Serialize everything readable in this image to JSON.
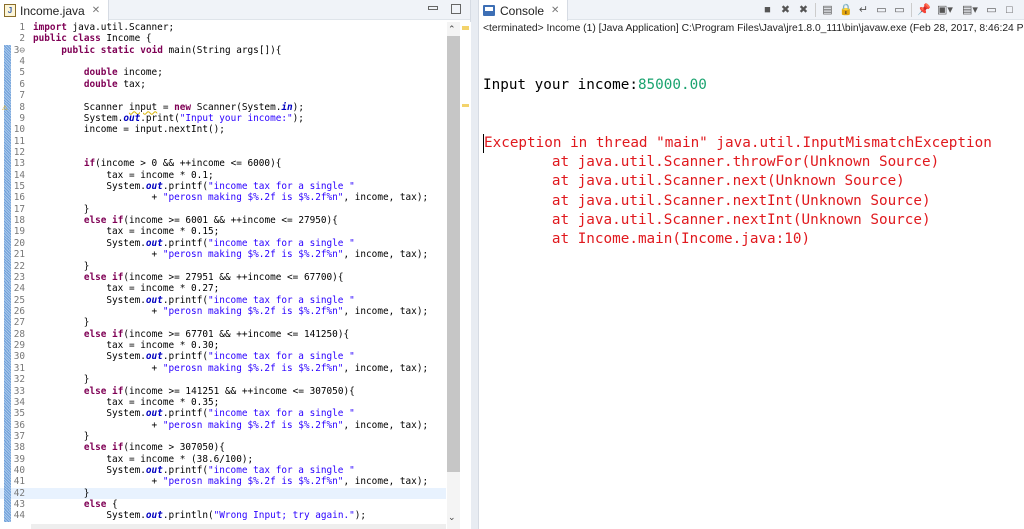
{
  "editor": {
    "tab_label": "Income.java",
    "close_glyph": "✕",
    "file_icon_letter": "J",
    "lines": [
      [
        [
          "kw",
          "import"
        ],
        [
          "p",
          " java.util.Scanner;"
        ]
      ],
      [
        [
          "kw",
          "public"
        ],
        [
          "p",
          " "
        ],
        [
          "kw",
          "class"
        ],
        [
          "p",
          " Income {"
        ]
      ],
      [
        [
          "p",
          "     "
        ],
        [
          "kw",
          "public"
        ],
        [
          "p",
          " "
        ],
        [
          "kw",
          "static"
        ],
        [
          "p",
          " "
        ],
        [
          "kw",
          "void"
        ],
        [
          "p",
          " main(String args[]){"
        ]
      ],
      [],
      [
        [
          "p",
          "         "
        ],
        [
          "kw",
          "double"
        ],
        [
          "p",
          " income;"
        ]
      ],
      [
        [
          "p",
          "         "
        ],
        [
          "kw",
          "double"
        ],
        [
          "p",
          " tax;"
        ]
      ],
      [],
      [
        [
          "p",
          "         Scanner "
        ],
        [
          "warn",
          "input"
        ],
        [
          "p",
          " = "
        ],
        [
          "kw",
          "new"
        ],
        [
          "p",
          " Scanner(System."
        ],
        [
          "fld",
          "in"
        ],
        [
          "p",
          ");"
        ]
      ],
      [
        [
          "p",
          "         System."
        ],
        [
          "fld",
          "out"
        ],
        [
          "p",
          ".print("
        ],
        [
          "str",
          "\"Input your income:\""
        ],
        [
          "p",
          ");"
        ]
      ],
      [
        [
          "p",
          "         income = input.nextInt();"
        ]
      ],
      [],
      [],
      [
        [
          "p",
          "         "
        ],
        [
          "kw",
          "if"
        ],
        [
          "p",
          "(income > 0 && ++income <= 6000){"
        ]
      ],
      [
        [
          "p",
          "             tax = income * 0.1;"
        ]
      ],
      [
        [
          "p",
          "             System."
        ],
        [
          "fld",
          "out"
        ],
        [
          "p",
          ".printf("
        ],
        [
          "str",
          "\"income tax for a single \""
        ]
      ],
      [
        [
          "p",
          "                     + "
        ],
        [
          "str",
          "\"perosn making $%.2f is $%.2f%n\""
        ],
        [
          "p",
          ", income, tax);"
        ]
      ],
      [
        [
          "p",
          "         }"
        ]
      ],
      [
        [
          "p",
          "         "
        ],
        [
          "kw",
          "else"
        ],
        [
          "p",
          " "
        ],
        [
          "kw",
          "if"
        ],
        [
          "p",
          "(income >= 6001 && ++income <= 27950){"
        ]
      ],
      [
        [
          "p",
          "             tax = income * 0.15;"
        ]
      ],
      [
        [
          "p",
          "             System."
        ],
        [
          "fld",
          "out"
        ],
        [
          "p",
          ".printf("
        ],
        [
          "str",
          "\"income tax for a single \""
        ]
      ],
      [
        [
          "p",
          "                     + "
        ],
        [
          "str",
          "\"perosn making $%.2f is $%.2f%n\""
        ],
        [
          "p",
          ", income, tax);"
        ]
      ],
      [
        [
          "p",
          "         }"
        ]
      ],
      [
        [
          "p",
          "         "
        ],
        [
          "kw",
          "else"
        ],
        [
          "p",
          " "
        ],
        [
          "kw",
          "if"
        ],
        [
          "p",
          "(income >= 27951 && ++income <= 67700){"
        ]
      ],
      [
        [
          "p",
          "             tax = income * 0.27;"
        ]
      ],
      [
        [
          "p",
          "             System."
        ],
        [
          "fld",
          "out"
        ],
        [
          "p",
          ".printf("
        ],
        [
          "str",
          "\"income tax for a single \""
        ]
      ],
      [
        [
          "p",
          "                     + "
        ],
        [
          "str",
          "\"perosn making $%.2f is $%.2f%n\""
        ],
        [
          "p",
          ", income, tax);"
        ]
      ],
      [
        [
          "p",
          "         }"
        ]
      ],
      [
        [
          "p",
          "         "
        ],
        [
          "kw",
          "else"
        ],
        [
          "p",
          " "
        ],
        [
          "kw",
          "if"
        ],
        [
          "p",
          "(income >= 67701 && ++income <= 141250){"
        ]
      ],
      [
        [
          "p",
          "             tax = income * 0.30;"
        ]
      ],
      [
        [
          "p",
          "             System."
        ],
        [
          "fld",
          "out"
        ],
        [
          "p",
          ".printf("
        ],
        [
          "str",
          "\"income tax for a single \""
        ]
      ],
      [
        [
          "p",
          "                     + "
        ],
        [
          "str",
          "\"perosn making $%.2f is $%.2f%n\""
        ],
        [
          "p",
          ", income, tax);"
        ]
      ],
      [
        [
          "p",
          "         }"
        ]
      ],
      [
        [
          "p",
          "         "
        ],
        [
          "kw",
          "else"
        ],
        [
          "p",
          " "
        ],
        [
          "kw",
          "if"
        ],
        [
          "p",
          "(income >= 141251 && ++income <= 307050){"
        ]
      ],
      [
        [
          "p",
          "             tax = income * 0.35;"
        ]
      ],
      [
        [
          "p",
          "             System."
        ],
        [
          "fld",
          "out"
        ],
        [
          "p",
          ".printf("
        ],
        [
          "str",
          "\"income tax for a single \""
        ]
      ],
      [
        [
          "p",
          "                     + "
        ],
        [
          "str",
          "\"perosn making $%.2f is $%.2f%n\""
        ],
        [
          "p",
          ", income, tax);"
        ]
      ],
      [
        [
          "p",
          "         }"
        ]
      ],
      [
        [
          "p",
          "         "
        ],
        [
          "kw",
          "else"
        ],
        [
          "p",
          " "
        ],
        [
          "kw",
          "if"
        ],
        [
          "p",
          "(income > 307050){"
        ]
      ],
      [
        [
          "p",
          "             tax = income * (38.6/100);"
        ]
      ],
      [
        [
          "p",
          "             System."
        ],
        [
          "fld",
          "out"
        ],
        [
          "p",
          ".printf("
        ],
        [
          "str",
          "\"income tax for a single \""
        ]
      ],
      [
        [
          "p",
          "                     + "
        ],
        [
          "str",
          "\"perosn making $%.2f is $%.2f%n\""
        ],
        [
          "p",
          ", income, tax);"
        ]
      ],
      [
        [
          "p",
          "         }"
        ]
      ],
      [
        [
          "p",
          "         "
        ],
        [
          "kw",
          "else"
        ],
        [
          "p",
          " {"
        ]
      ],
      [
        [
          "p",
          "             System."
        ],
        [
          "fld",
          "out"
        ],
        [
          "p",
          ".println("
        ],
        [
          "str",
          "\"Wrong Input; try again.\""
        ],
        [
          "p",
          ");"
        ]
      ]
    ]
  },
  "console": {
    "tab_label": "Console",
    "close_glyph": "✕",
    "status": "<terminated> Income (1) [Java Application] C:\\Program Files\\Java\\jre1.8.0_111\\bin\\javaw.exe (Feb 28, 2017, 8:46:24 PM)",
    "prompt": "Input your income:",
    "user_input": "85000.00",
    "error_lines": [
      "Exception in thread \"main\" java.util.InputMismatchException",
      "\tat java.util.Scanner.throwFor(Unknown Source)",
      "\tat java.util.Scanner.next(Unknown Source)",
      "\tat java.util.Scanner.nextInt(Unknown Source)",
      "\tat java.util.Scanner.nextInt(Unknown Source)",
      "\tat Income.main(Income.java:10)"
    ],
    "toolbar_icons": [
      "terminate-icon",
      "remove-launch-icon",
      "remove-all-terminated-icon",
      "clear-console-icon",
      "scroll-lock-icon",
      "word-wrap-icon",
      "show-on-stdout-icon",
      "show-on-stderr-icon",
      "pin-console-icon",
      "display-console-icon",
      "open-console-icon"
    ]
  },
  "colors": {
    "keyword": "#7f0055",
    "string": "#2a00ff",
    "field": "#0000c0",
    "stdin": "#1aa36f",
    "stderr": "#e0191e"
  }
}
